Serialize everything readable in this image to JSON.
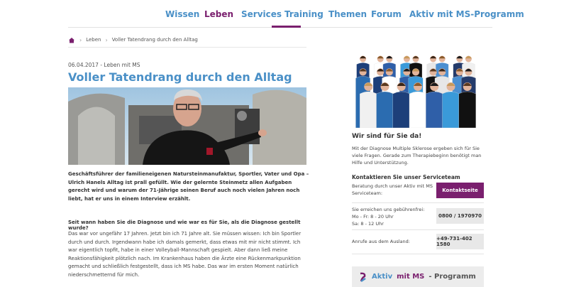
{
  "nav": {
    "items": [
      {
        "label": "Wissen"
      },
      {
        "label": "Leben",
        "active": true
      },
      {
        "label": "Services"
      },
      {
        "label": "Training"
      },
      {
        "label": "Themen"
      },
      {
        "label": "Forum"
      },
      {
        "label": "Aktiv mit MS-Programm"
      }
    ]
  },
  "breadcrumb": {
    "home_icon": "home-icon",
    "items": [
      "Leben",
      "Voller Tatendrang durch den Alltag"
    ]
  },
  "article": {
    "meta": "06.04.2017 - Leben mit MS",
    "title": "Voller Tatendrang durch den Alltag",
    "lead": "Geschäftsführer der familieneigenen Natursteinmanufaktur, Sportler, Vater und Opa – Ulrich Hanels Alltag ist prall gefüllt. Wie der gelernte Steinmetz allen Aufgaben gerecht wird und warum der 71-Jährige seinen Beruf auch noch vielen Jahren noch liebt, hat er uns in einem Interview erzählt.",
    "question": "Seit wann haben Sie die Diagnose und wie war es für Sie, als die Diagnose gestellt wurde?",
    "body": "Das war vor ungefähr 17 Jahren. Jetzt bin ich 71 Jahre alt. Sie müssen wissen: Ich bin Sportler durch und durch. Irgendwann habe ich damals gemerkt, dass etwas mit mir nicht stimmt. Ich war eigentlich topfit, habe in einer Volleyball-Mannschaft gespielt. Aber dann ließ meine Reaktionsfähigkeit plötzlich nach. Im Krankenhaus haben die Ärzte eine Rückenmarkpunktion gemacht und schließlich festgestellt, dass ich MS habe. Das war im ersten Moment natürlich niederschmetternd für mich."
  },
  "sidebar": {
    "heading": "Wir sind für Sie da!",
    "intro": "Mit der Diagnose Multiple Sklerose ergeben sich für Sie viele Fragen. Gerade zum Therapiebeginn benötigt man Hilfe und Unterstützung.",
    "contact_heading": "Kontaktieren Sie unser Serviceteam",
    "advice_text": "Beratung durch unser Aktiv mit MS Serviceteam:",
    "contact_button": "Kontaktseite",
    "hours_title": "Sie erreichen uns gebührenfrei:",
    "hours_weekday": "Mo - Fr: 8 - 20 Uhr",
    "hours_saturday": "Sa: 8 - 12 Uhr",
    "phone_free": "0800 / 1970970",
    "abroad_label": "Anrufe aus dem Ausland:",
    "phone_abroad": "+49-731-402 1580",
    "programm": {
      "pre": "Aktiv",
      "mid": "mit MS",
      "post": "- Programm"
    }
  },
  "colors": {
    "accent_blue": "#4a90c7",
    "brand_purple": "#7a1f6e"
  }
}
